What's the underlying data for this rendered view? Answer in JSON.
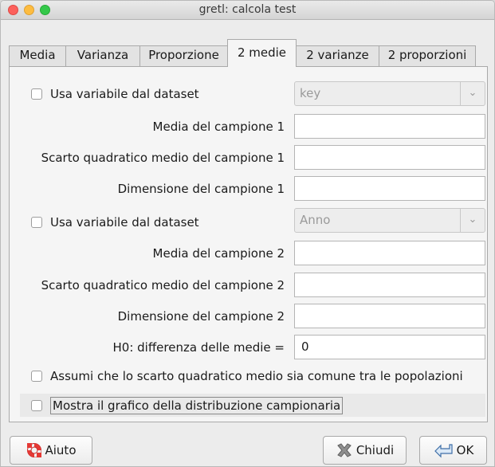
{
  "window": {
    "title": "gretl: calcola test"
  },
  "tabs": [
    {
      "label": "Media"
    },
    {
      "label": "Varianza"
    },
    {
      "label": "Proporzione"
    },
    {
      "label": "2 medie"
    },
    {
      "label": "2 varianze"
    },
    {
      "label": "2 proporzioni"
    }
  ],
  "active_tab": "2 medie",
  "sample1": {
    "use_dataset_label": "Usa variabile dal dataset",
    "variable_combo_value": "key",
    "mean_label": "Media del campione 1",
    "mean_value": "",
    "sd_label": "Scarto quadratico medio del campione 1",
    "sd_value": "",
    "size_label": "Dimensione del campione 1",
    "size_value": ""
  },
  "sample2": {
    "use_dataset_label": "Usa variabile dal dataset",
    "variable_combo_value": "Anno",
    "mean_label": "Media del campione 2",
    "mean_value": "",
    "sd_label": "Scarto quadratico medio del campione 2",
    "sd_value": "",
    "size_label": "Dimensione del campione 2",
    "size_value": ""
  },
  "h0": {
    "label": "H0: differenza delle medie =",
    "value": "0"
  },
  "options": {
    "common_sd_label": "Assumi che lo scarto quadratico medio sia comune tra le popolazioni",
    "show_graph_label": "Mostra il grafico della distribuzione campionaria"
  },
  "buttons": {
    "help": "Aiuto",
    "close": "Chiudi",
    "ok": "OK"
  },
  "colors": {
    "close": "#fc605c",
    "minimize": "#fdbc40",
    "maximize": "#34c84a"
  }
}
